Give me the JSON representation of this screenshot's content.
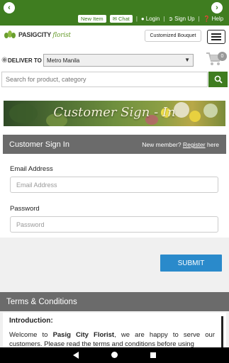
{
  "topbar": {
    "new_item": "New Item",
    "chat": "Chat",
    "login": "Login",
    "signup": "Sign Up",
    "help": "Help"
  },
  "header": {
    "logo_main": "PASIGCITY",
    "logo_script": "florist",
    "customized_bouquet": "Customized Bouquet"
  },
  "deliver": {
    "label": "DELIVER TO",
    "location": "Metro Manila",
    "cart_count": "0"
  },
  "search": {
    "placeholder": "Search for product, category"
  },
  "banner": {
    "title": "Customer Sign - In"
  },
  "signin": {
    "title": "Customer Sign In",
    "new_member": "New member?",
    "register": "Register",
    "here": "here",
    "email_label": "Email Address",
    "email_placeholder": "Email Address",
    "password_label": "Password",
    "password_placeholder": "Password",
    "submit": "SUBMIT"
  },
  "terms": {
    "title": "Terms & Conditions",
    "intro_heading": "Introduction:",
    "text_before": "Welcome to ",
    "brand": "Pasig City Florist",
    "text_after": ", we are happy to serve our customers. Please read the terms and conditions before using"
  },
  "colors": {
    "brand_green": "#3f7d20",
    "header_grey": "#6b6b6b",
    "submit_blue": "#2a8acb"
  }
}
